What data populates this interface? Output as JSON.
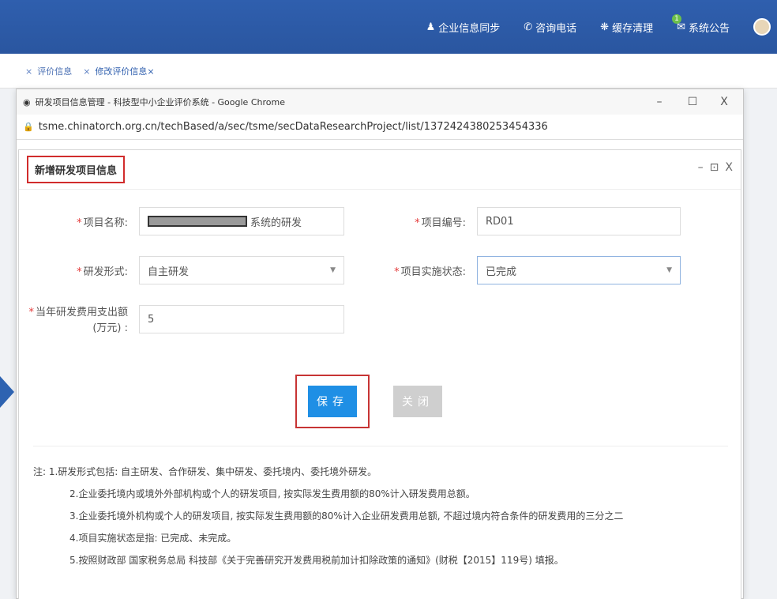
{
  "topbar": {
    "items": [
      {
        "icon": "user-icon",
        "label": "企业信息同步"
      },
      {
        "icon": "phone-icon",
        "label": "咨询电话"
      },
      {
        "icon": "clean-icon",
        "label": "缓存清理"
      },
      {
        "icon": "mail-icon",
        "label": "系统公告",
        "badge": "1"
      }
    ]
  },
  "tabs": [
    {
      "label": "评价信息"
    },
    {
      "label": "修改评价信息×"
    }
  ],
  "chrome": {
    "title": "研发项目信息管理 - 科技型中小企业评价系统 - Google Chrome",
    "url": "tsme.chinatorch.org.cn/techBased/a/sec/tsme/secDataResearchProject/list/1372424380253454336",
    "minimize": "–",
    "maximize": "☐",
    "close": "X"
  },
  "dialog": {
    "title": "新增研发项目信息",
    "ctrl_min": "–",
    "ctrl_max": "⊡",
    "ctrl_close": "X",
    "fields": {
      "project_name_label": "项目名称:",
      "project_name_value": "系统的研发",
      "project_no_label": "项目编号:",
      "project_no_value": "RD01",
      "rd_form_label": "研发形式:",
      "rd_form_value": "自主研发",
      "status_label": "项目实施状态:",
      "status_value": "已完成",
      "expense_label_1": "当年研发费用支出额",
      "expense_label_2": "(万元) :",
      "expense_value": "5"
    },
    "save_label": "保存",
    "close_label": "关闭",
    "notes": [
      "注: 1.研发形式包括: 自主研发、合作研发、集中研发、委托境内、委托境外研发。",
      "2.企业委托境内或境外外部机构或个人的研发项目, 按实际发生费用额的80%计入研发费用总额。",
      "3.企业委托境外机构或个人的研发项目, 按实际发生费用额的80%计入企业研发费用总额, 不超过境内符合条件的研发费用的三分之二",
      "4.项目实施状态是指: 已完成、未完成。",
      "5.按照财政部 国家税务总局 科技部《关于完善研究开发费用税前加计扣除政策的通知》(财税【2015】119号) 填报。"
    ]
  },
  "colors": {
    "header_bg": "#2f5fae",
    "save_button": "#1f8fe5",
    "highlight": "#d12c2c"
  }
}
